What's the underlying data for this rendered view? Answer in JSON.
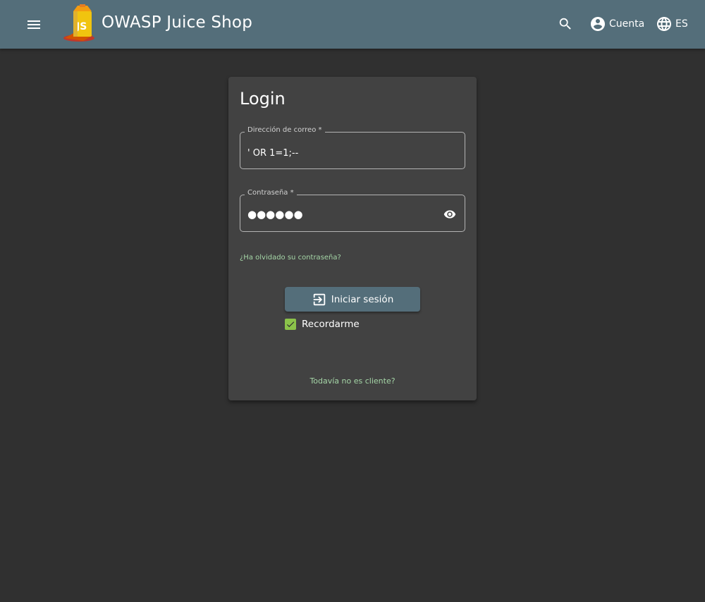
{
  "header": {
    "app_title": "OWASP Juice Shop",
    "menu_icon": "menu-icon",
    "search_icon": "search-icon",
    "account_label": "Cuenta",
    "language_label": "ES"
  },
  "login": {
    "title": "Login",
    "email_label": "Dirección de correo *",
    "email_value": "' OR 1=1;--",
    "password_label": "Contraseña *",
    "password_masked": "●●●●●●",
    "forgot_password": "¿Ha olvidado su contraseña?",
    "login_button": "Iniciar sesión",
    "remember_me": "Recordarme",
    "remember_me_checked": true,
    "register_link": "Todavía no es cliente?"
  },
  "colors": {
    "toolbar": "#546e7a",
    "background": "#303030",
    "card": "#424242",
    "accent_link": "#a5d6a7",
    "checkbox": "#8bc34a"
  }
}
